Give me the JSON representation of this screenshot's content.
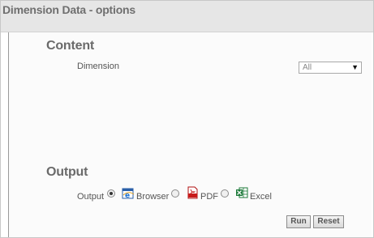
{
  "window": {
    "title": "Dimension Data - options"
  },
  "content": {
    "heading": "Content",
    "dimension_label": "Dimension",
    "dimension_select": {
      "value": "All"
    }
  },
  "output": {
    "heading": "Output",
    "label": "Output",
    "selected": "Browser",
    "options": [
      {
        "label": "Browser",
        "icon": "browser-icon",
        "checked": true
      },
      {
        "label": "PDF",
        "icon": "pdf-icon",
        "checked": false
      },
      {
        "label": "Excel",
        "icon": "excel-icon",
        "checked": false
      }
    ]
  },
  "buttons": {
    "run": "Run",
    "reset": "Reset"
  }
}
